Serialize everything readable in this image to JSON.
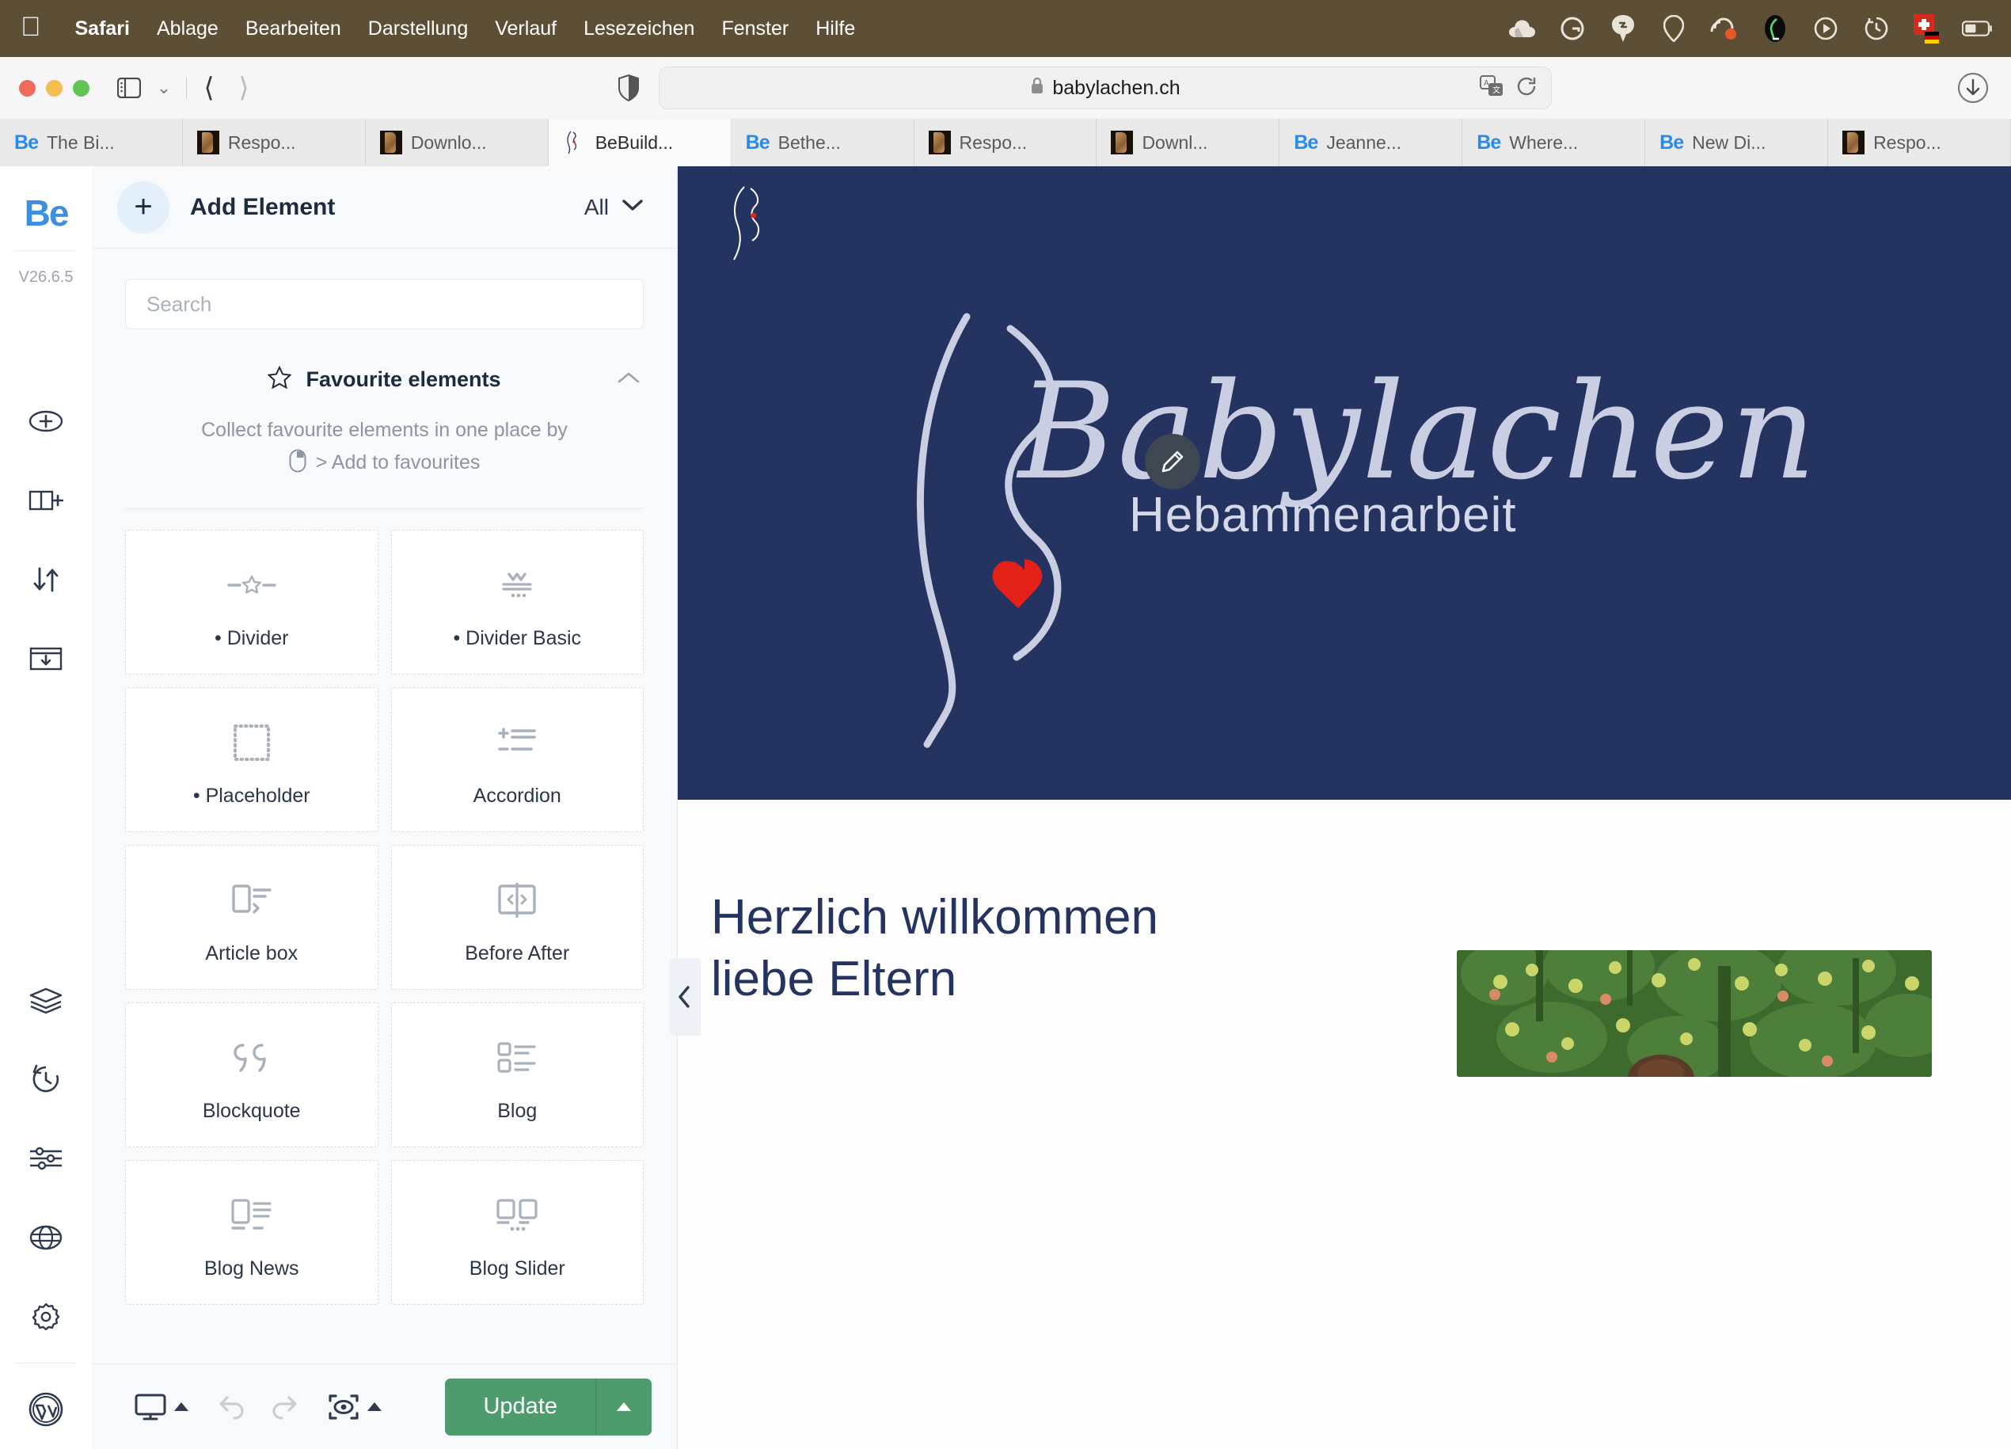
{
  "menubar": {
    "apple_icon": "apple-logo",
    "items": [
      {
        "label": "Safari",
        "bold": true
      },
      {
        "label": "Ablage",
        "bold": false
      },
      {
        "label": "Bearbeiten",
        "bold": false
      },
      {
        "label": "Darstellung",
        "bold": false
      },
      {
        "label": "Verlauf",
        "bold": false
      },
      {
        "label": "Lesezeichen",
        "bold": false
      },
      {
        "label": "Fenster",
        "bold": false
      },
      {
        "label": "Hilfe",
        "bold": false
      }
    ],
    "status_icons": [
      "cloud-icon",
      "grammarly-icon",
      "shortcut-icon",
      "location-pin-icon",
      "loom-icon",
      "paw-icon",
      "playback-icon",
      "time-machine-icon",
      "language-flag-icon",
      "battery-icon"
    ]
  },
  "browser": {
    "traffic_lights": [
      "close",
      "minimize",
      "zoom"
    ],
    "sidebar_icon": "sidebar-toggle-icon",
    "sidebar_chevron": "chevron-down-icon",
    "back_icon": "chevron-left-icon",
    "forward_icon": "chevron-right-icon",
    "shield_icon": "privacy-shield-icon",
    "url": "babylachen.ch",
    "lock_icon": "lock-icon",
    "translate_icon": "translate-icon",
    "reload_icon": "reload-icon",
    "download_icon": "download-icon",
    "tabs": [
      {
        "label": "The Bi...",
        "favicon": "be",
        "active": false
      },
      {
        "label": "Respo...",
        "favicon": "wood",
        "active": false
      },
      {
        "label": "Downlo...",
        "favicon": "wood",
        "active": false
      },
      {
        "label": "BeBuild...",
        "favicon": "bb",
        "active": true
      },
      {
        "label": "Bethe...",
        "favicon": "be",
        "active": false
      },
      {
        "label": "Respo...",
        "favicon": "wood",
        "active": false
      },
      {
        "label": "Downl...",
        "favicon": "wood",
        "active": false
      },
      {
        "label": "Jeanne...",
        "favicon": "be",
        "active": false
      },
      {
        "label": "Where...",
        "favicon": "be",
        "active": false
      },
      {
        "label": "New Di...",
        "favicon": "be",
        "active": false
      },
      {
        "label": "Respo...",
        "favicon": "wood",
        "active": false
      }
    ]
  },
  "rail": {
    "logo": "Be",
    "version": "V26.6.5",
    "top_icons": [
      {
        "name": "add-section-icon"
      },
      {
        "name": "add-row-icon"
      },
      {
        "name": "reorder-icon"
      },
      {
        "name": "insert-template-icon"
      }
    ],
    "bottom_icons": [
      {
        "name": "layers-icon"
      },
      {
        "name": "history-icon"
      },
      {
        "name": "options-icon"
      },
      {
        "name": "globe-icon"
      },
      {
        "name": "settings-gear-icon"
      }
    ],
    "wordpress_icon": "wordpress-icon"
  },
  "panel": {
    "add_element_label": "Add Element",
    "plus_icon": "plus-icon",
    "filter_value": "All",
    "filter_chevron": "chevron-down-icon",
    "search_placeholder": "Search",
    "search_value": "",
    "favourites": {
      "star_icon": "star-icon",
      "title": "Favourite elements",
      "collapse_icon": "chevron-up-icon",
      "description": "Collect favourite elements in one place by",
      "mouse_icon": "mouse-right-click-icon",
      "link_text": "> Add to favourites"
    },
    "elements": [
      {
        "name": "• Divider",
        "icon": "divider-star-icon"
      },
      {
        "name": "• Divider Basic",
        "icon": "divider-basic-icon"
      },
      {
        "name": "• Placeholder",
        "icon": "placeholder-icon"
      },
      {
        "name": "Accordion",
        "icon": "accordion-icon"
      },
      {
        "name": "Article box",
        "icon": "article-box-icon"
      },
      {
        "name": "Before After",
        "icon": "before-after-icon"
      },
      {
        "name": "Blockquote",
        "icon": "blockquote-icon"
      },
      {
        "name": "Blog",
        "icon": "blog-icon"
      },
      {
        "name": "Blog News",
        "icon": "blog-news-icon"
      },
      {
        "name": "Blog Slider",
        "icon": "blog-slider-icon"
      }
    ],
    "footer": {
      "device_icon": "desktop-monitor-icon",
      "device_caret": "caret-up-icon",
      "undo_icon": "undo-icon",
      "redo_icon": "redo-icon",
      "preview_icon": "preview-eye-icon",
      "preview_caret": "caret-up-icon",
      "update_label": "Update",
      "update_caret": "caret-up-icon"
    },
    "collapse_handle_icon": "chevron-left-icon"
  },
  "preview": {
    "hero": {
      "background_color": "#253361",
      "logo_mark": "pregnant-silhouette-logo",
      "title": "Babylachen",
      "subtitle": "Hebammenarbeit",
      "heart_color": "#e32119",
      "edit_icon": "pencil-edit-icon"
    },
    "content": {
      "heading_line1": "Herzlich willkommen",
      "heading_line2": "liebe Eltern",
      "image_alt": "apple-orchard-photo"
    }
  },
  "colors": {
    "brand_blue": "#3f8fe0",
    "navy": "#253361",
    "update_green": "#4e9c6d",
    "menubar": "#5d4e36"
  }
}
